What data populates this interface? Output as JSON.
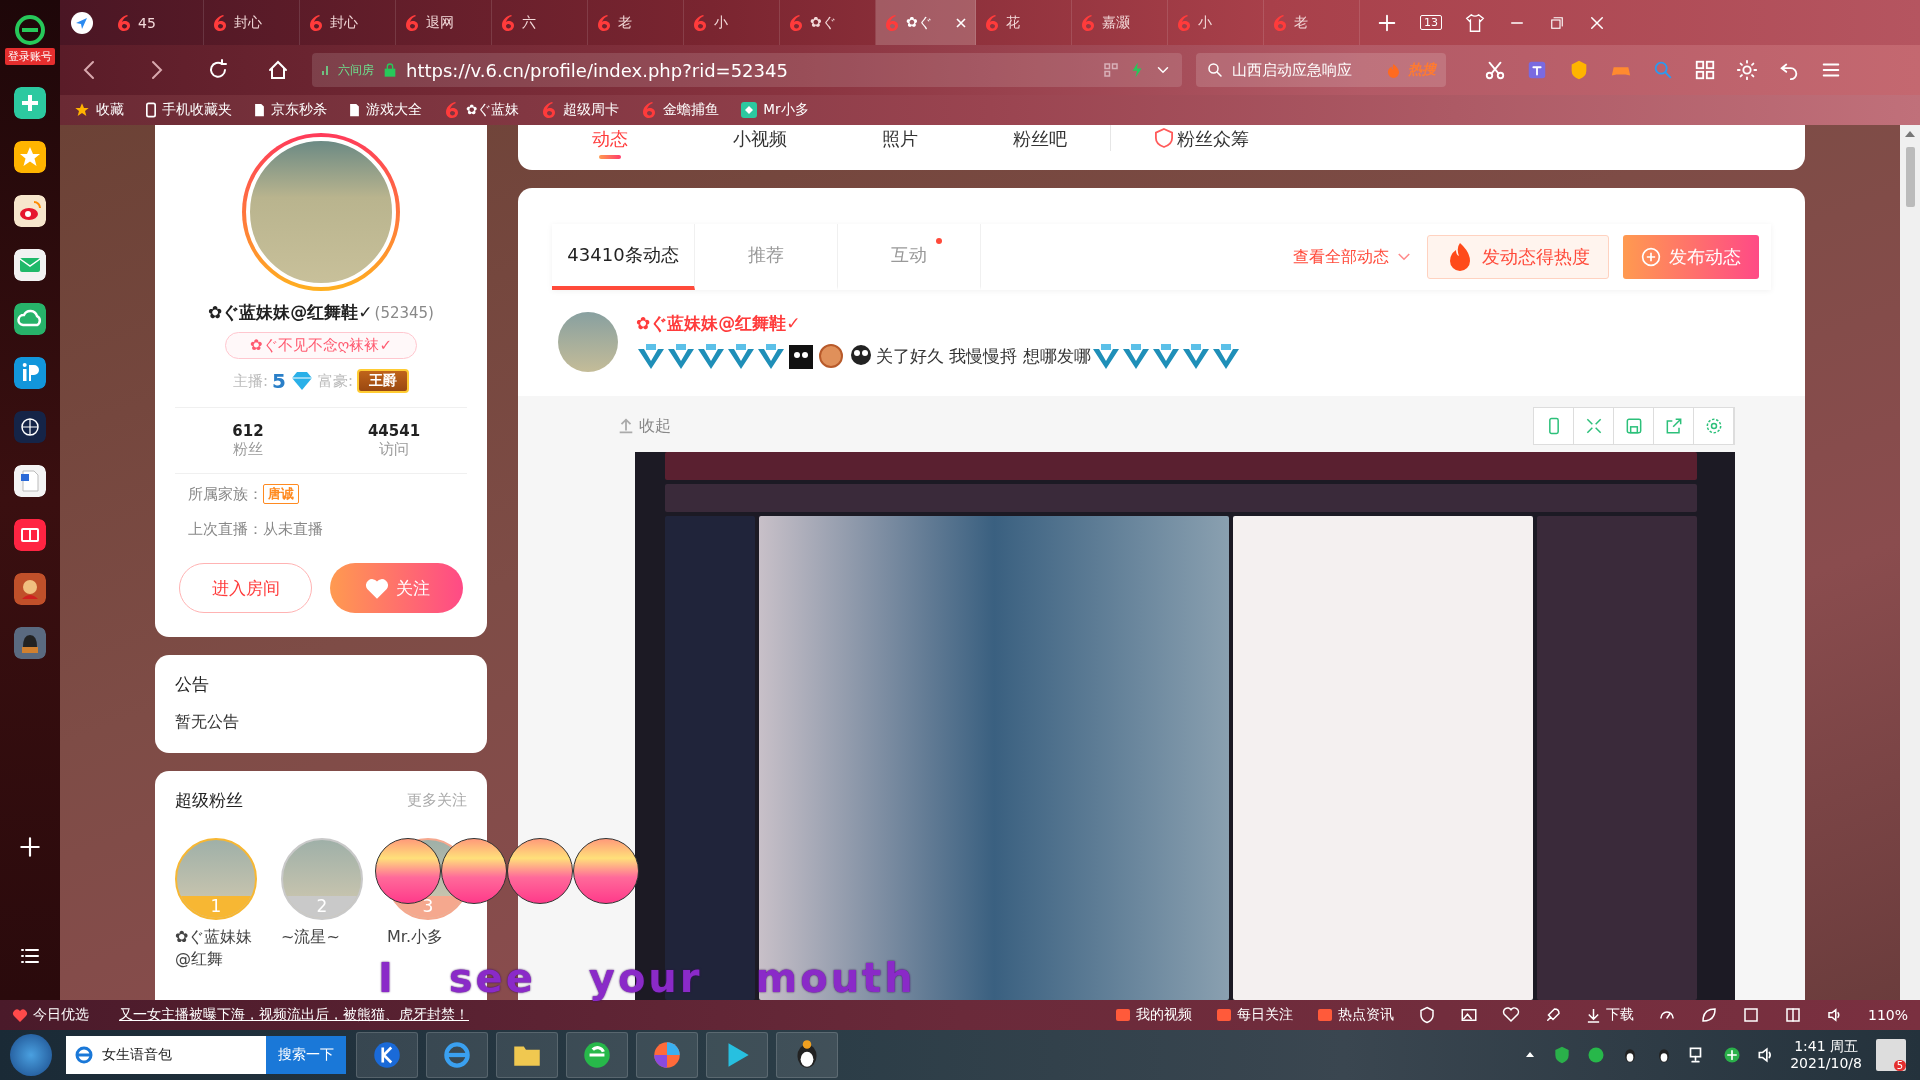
{
  "browser": {
    "tabs": [
      {
        "label": "45",
        "selected": false
      },
      {
        "label": "封心",
        "selected": false
      },
      {
        "label": "封心",
        "selected": false
      },
      {
        "label": "退网",
        "selected": false
      },
      {
        "label": "六",
        "selected": false
      },
      {
        "label": "老",
        "selected": false
      },
      {
        "label": "小",
        "selected": false
      },
      {
        "label": "✿ぐ",
        "selected": false
      },
      {
        "label": "✿ぐ",
        "selected": true
      },
      {
        "label": "花",
        "selected": false
      },
      {
        "label": "嘉灏",
        "selected": false
      },
      {
        "label": "小",
        "selected": false
      },
      {
        "label": "老",
        "selected": false
      }
    ],
    "tab_count": "13",
    "site_label": "六间房",
    "url": "https://v.6.cn/profile/index.php?rid=52345",
    "search_value": "山西启动应急响应",
    "hot_label": "热搜",
    "bookmarks": [
      {
        "label": "收藏",
        "kind": "star"
      },
      {
        "label": "手机收藏夹",
        "kind": "phone"
      },
      {
        "label": "京东秒杀",
        "kind": "page"
      },
      {
        "label": "游戏大全",
        "kind": "page"
      },
      {
        "label": "✿ぐ蓝妹",
        "kind": "site"
      },
      {
        "label": "超级周卡",
        "kind": "site"
      },
      {
        "label": "金蟾捕鱼",
        "kind": "site"
      },
      {
        "label": "Mr小多",
        "kind": "app"
      }
    ]
  },
  "rail": {
    "login_label": "登录账号"
  },
  "nav": [
    {
      "label": "动态",
      "selected": true
    },
    {
      "label": "小视频",
      "selected": false
    },
    {
      "label": "照片",
      "selected": false
    },
    {
      "label": "粉丝吧",
      "selected": false
    },
    {
      "label": "粉丝众筹",
      "selected": false
    }
  ],
  "profile": {
    "name": "✿ぐ蓝妹妹@红舞鞋✓",
    "id": "(52345)",
    "signature": "✿ぐ不见不念ღ袜袜✓",
    "anchor_label": "主播:",
    "anchor_level": "5",
    "rich_label": "富豪:",
    "rich_badge": "王爵",
    "stats": [
      {
        "value": "612",
        "label": "粉丝"
      },
      {
        "value": "44541",
        "label": "访问"
      }
    ],
    "family_label": "所属家族：",
    "family_badge": "唐诚",
    "last_live": "上次直播：从未直播",
    "enter_button": "进入房间",
    "follow_button": "关注"
  },
  "notice": {
    "title": "公告",
    "text": "暂无公告"
  },
  "super_fans": {
    "title": "超级粉丝",
    "more": "更多关注",
    "fans": [
      {
        "rank": "1",
        "name": "✿ぐ蓝妹妹@红舞",
        "color": "#f7b733"
      },
      {
        "rank": "2",
        "name": "~流星~",
        "color": "#c9c9c9"
      },
      {
        "rank": "3",
        "name": "Mr.小多",
        "color": "#f5a88e"
      }
    ]
  },
  "feed": {
    "tabs": [
      {
        "label": "43410条动态",
        "selected": true,
        "unread": false
      },
      {
        "label": "推荐",
        "selected": false,
        "unread": false
      },
      {
        "label": "互动",
        "selected": false,
        "unread": true
      }
    ],
    "view_all": "查看全部动态",
    "hot_button": "发动态得热度",
    "publish_button": "发布动态",
    "post": {
      "author": "✿ぐ蓝妹妹@红舞鞋✓",
      "text": "关了好久 我慢慢捋 想哪发哪",
      "collapse": "收起"
    }
  },
  "overlay": {
    "caption": "I see your mouth"
  },
  "news_bar": {
    "pick_label": "今日优选",
    "headline": "又一女主播被曝下海，视频流出后，被熊猫、虎牙封禁！",
    "links": [
      "我的视频",
      "每日关注",
      "热点资讯"
    ],
    "download": "下载",
    "zoom": "110%"
  },
  "taskbar": {
    "search_value": "女生语音包",
    "search_button": "搜索一下",
    "time": "1:41 周五",
    "date": "2021/10/8",
    "notification_count": "5"
  }
}
